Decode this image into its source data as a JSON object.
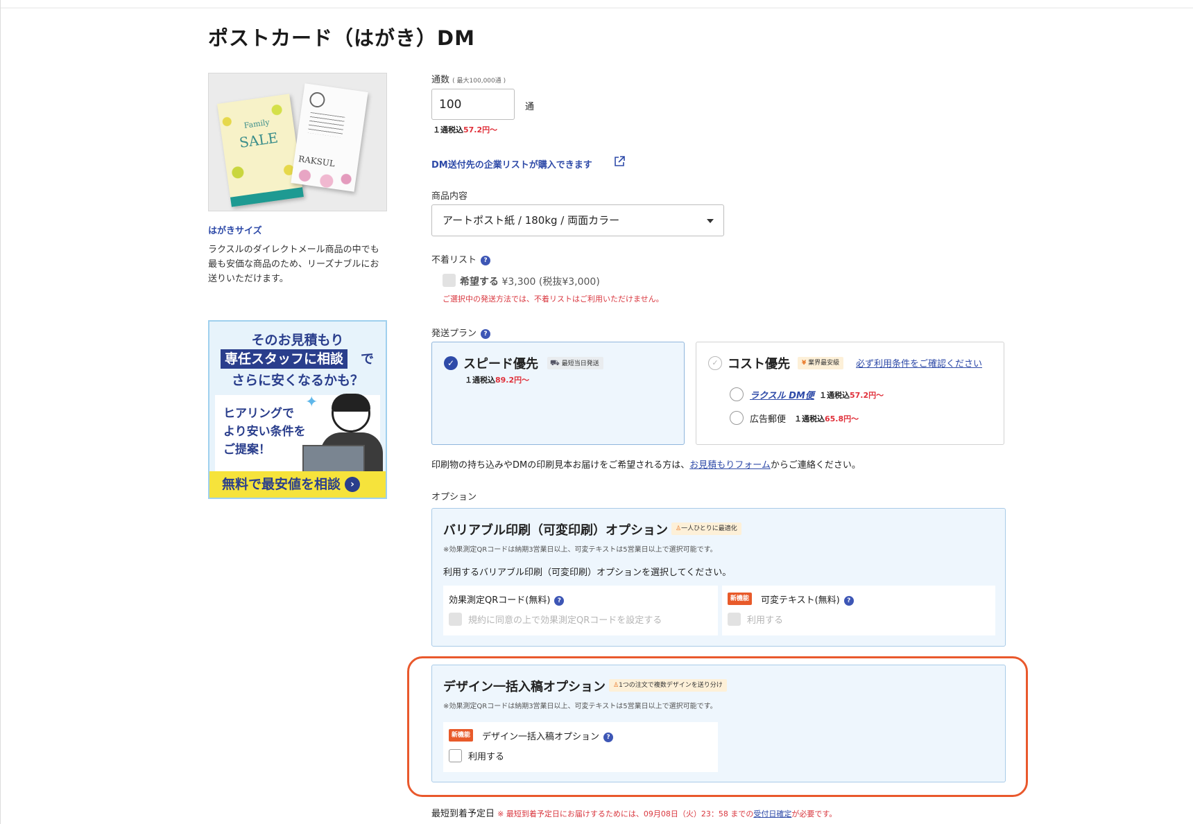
{
  "page": {
    "title": "ポストカード（はがき）DM"
  },
  "left": {
    "size_link": "はがきサイズ",
    "description": "ラクスルのダイレクトメール商品の中でも最も安価な商品のため、リーズナブルにお送りいただけます。",
    "product_image": {
      "card_a_headline": "SALE",
      "card_a_sub": "Family",
      "card_b_brand": "RAKSUL"
    },
    "banner": {
      "line1": "そのお見積もり",
      "line2_highlight": "専任スタッフに相談",
      "line2_tail": "で",
      "line3": "さらに安くなるかも？",
      "body": "ヒアリングで\nより安い条件を\nご提案！",
      "cta": "無料で最安値を相談",
      "cta_arrow": "›"
    }
  },
  "quantity": {
    "label": "通数",
    "label_note": "( 最大100,000通 )",
    "value": "100",
    "unit": "通",
    "price_prefix": "１通税込",
    "price": "57.2円〜"
  },
  "company_list_link": "DM送付先の企業リストが購入できます",
  "product": {
    "label": "商品内容",
    "selected": "アートポスト紙 / 180kg / 両面カラー"
  },
  "return_list": {
    "label": "不着リスト",
    "option_label": "希望する",
    "option_price": "¥3,300 (税抜¥3,000)",
    "warning": "ご選択中の発送方法では、不着リストはご利用いただけません。"
  },
  "shipping": {
    "label": "発送プラン",
    "speed": {
      "title": "スピード優先",
      "tag": "最短当日発送",
      "price_prefix": "１通税込",
      "price": "89.2円〜"
    },
    "cost": {
      "title": "コスト優先",
      "tag_yen": "¥",
      "tag": "業界最安級",
      "terms_link": "必ず利用条件をご確認ください",
      "options": [
        {
          "name": "ラクスル DM便",
          "price_prefix": "１通税込",
          "price": "57.2円〜"
        },
        {
          "name": "広告郵便",
          "price_prefix": "１通税込",
          "price": "65.8円〜"
        }
      ]
    }
  },
  "note": {
    "before": "印刷物の持ち込みやDMの印刷見本お届けをご希望される方は、",
    "link": "お見積もりフォーム",
    "after": "からご連絡ください。"
  },
  "options": {
    "label": "オプション",
    "variable": {
      "title": "バリアブル印刷（可変印刷）オプション",
      "tag": "一人ひとりに最適化",
      "note": "※効果測定QRコードは納期3営業日以上、可変テキストは5営業日以上で選択可能です。",
      "instruction": "利用するバリアブル印刷（可変印刷）オプションを選択してください。",
      "qr_label": "効果測定QRコード(無料)",
      "qr_checkbox": "規約に同意の上で効果測定QRコードを設定する",
      "new_badge": "新機能",
      "text_label": "可変テキスト(無料)",
      "text_checkbox": "利用する"
    },
    "design": {
      "title": "デザイン一括入稿オプション",
      "tag": "1つの注文で複数デザインを送り分け",
      "note": "※効果測定QRコードは納期3営業日以上、可変テキストは5営業日以上で選択可能です。",
      "new_badge": "新機能",
      "label": "デザイン一括入稿オプション",
      "checkbox": "利用する"
    }
  },
  "arrival": {
    "label": "最短到着予定日",
    "note_prefix": "※ 最短到着予定日にお届けするためには、09月08日（火）23：58 までの",
    "note_link": "受付日確定",
    "note_suffix": "が必要です。"
  },
  "colors": {
    "accent_blue": "#2e4aa8",
    "price_red": "#e0303a",
    "highlight_outline": "#e9582c",
    "option_bg": "#eef6fd"
  }
}
